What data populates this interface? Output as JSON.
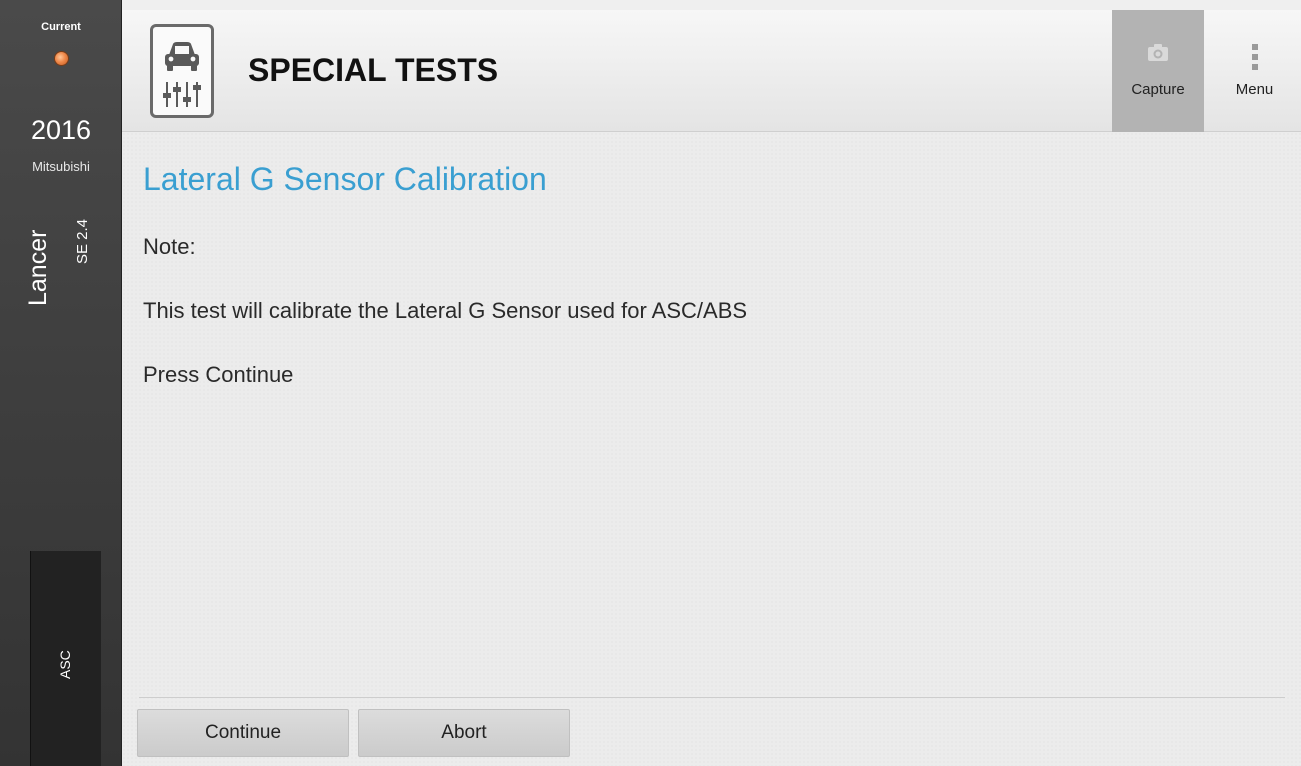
{
  "sidebar": {
    "status": "Current",
    "year": "2016",
    "make": "Mitsubishi",
    "model": "Lancer",
    "trim": "SE 2.4",
    "module": "ASC",
    "status_dot_color": "#f0894a"
  },
  "header": {
    "title": "SPECIAL TESTS",
    "app_icon": "car-sliders-icon",
    "capture_label": "Capture",
    "capture_icon": "camera-icon",
    "menu_label": "Menu",
    "menu_icon": "vertical-dots-icon"
  },
  "main": {
    "test_title": "Lateral G Sensor Calibration",
    "lines": [
      "Note:",
      "This test will calibrate the Lateral G Sensor used for ASC/ABS",
      "Press Continue"
    ],
    "accent_color": "#3a9fd1"
  },
  "actions": {
    "continue_label": "Continue",
    "abort_label": "Abort"
  }
}
